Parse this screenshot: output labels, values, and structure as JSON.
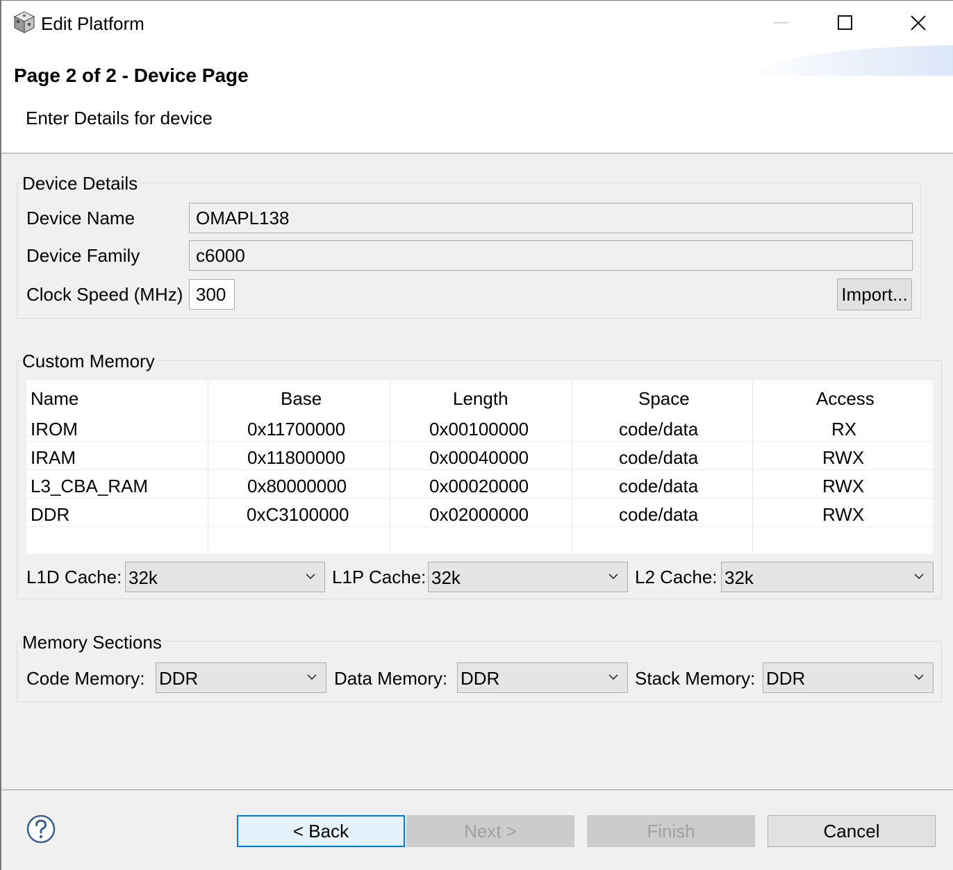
{
  "window": {
    "title": "Edit Platform",
    "icon": "cube-icon",
    "controls": {
      "minimize": "minimize-icon",
      "maximize": "maximize-icon",
      "close": "close-icon"
    }
  },
  "header": {
    "page_title": "Page 2 of 2 - Device Page",
    "description": "Enter Details for device"
  },
  "device_details": {
    "group_label": "Device Details",
    "device_name_label": "Device Name",
    "device_name_value": "OMAPL138",
    "device_family_label": "Device Family",
    "device_family_value": "c6000",
    "clock_speed_label": "Clock Speed (MHz)",
    "clock_speed_value": "300",
    "import_label": "Import..."
  },
  "custom_memory": {
    "group_label": "Custom Memory",
    "columns": [
      "Name",
      "Base",
      "Length",
      "Space",
      "Access"
    ],
    "rows": [
      [
        "IROM",
        "0x11700000",
        "0x00100000",
        "code/data",
        "RX"
      ],
      [
        "IRAM",
        "0x11800000",
        "0x00040000",
        "code/data",
        "RWX"
      ],
      [
        "L3_CBA_RAM",
        "0x80000000",
        "0x00020000",
        "code/data",
        "RWX"
      ],
      [
        "DDR",
        "0xC3100000",
        "0x02000000",
        "code/data",
        "RWX"
      ]
    ],
    "l1d_label": "L1D Cache:",
    "l1d_value": "32k",
    "l1p_label": "L1P Cache:",
    "l1p_value": "32k",
    "l2_label": "L2 Cache:",
    "l2_value": "32k"
  },
  "memory_sections": {
    "group_label": "Memory Sections",
    "code_label": "Code Memory:",
    "code_value": "DDR",
    "data_label": "Data Memory:",
    "data_value": "DDR",
    "stack_label": "Stack Memory:",
    "stack_value": "DDR"
  },
  "footer": {
    "help_icon": "help-icon",
    "back_label": "< Back",
    "next_label": "Next >",
    "finish_label": "Finish",
    "cancel_label": "Cancel"
  },
  "colors": {
    "dialog_bg": "#f0f0f0",
    "accent": "#0078d7",
    "disabled_text": "#a0a0a0"
  }
}
